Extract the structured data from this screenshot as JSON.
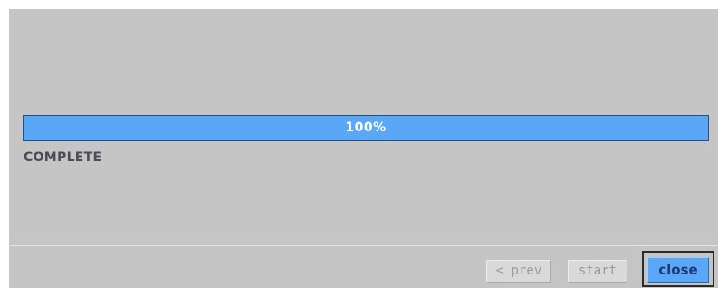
{
  "progress": {
    "label": "100%",
    "value": 100,
    "fill_color": "#5aa7f7"
  },
  "status": {
    "text": "COMPLETE"
  },
  "footer": {
    "prev_label": "< prev",
    "start_label": "start",
    "close_label": "close",
    "prev_enabled": false,
    "start_enabled": false,
    "close_enabled": true
  },
  "colors": {
    "background": "#c5c5c5",
    "accent": "#5aa7f7",
    "status_text": "#4c4c58"
  }
}
